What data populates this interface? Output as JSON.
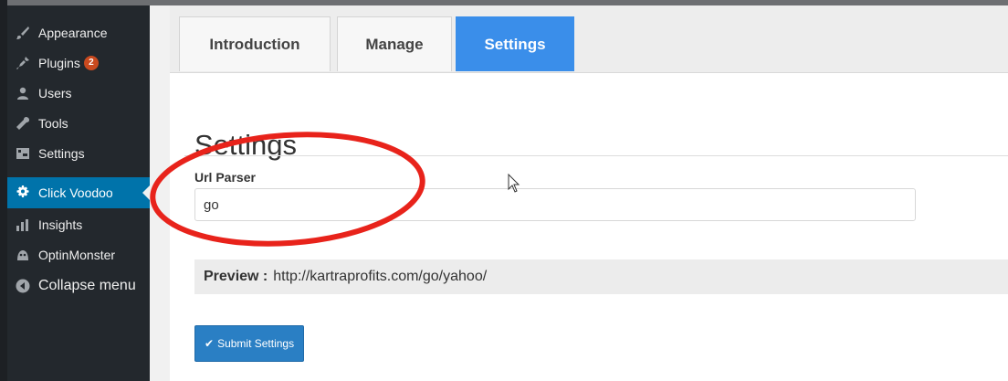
{
  "sidebar": {
    "items": [
      {
        "label": "Appearance",
        "icon": "paintbrush-icon"
      },
      {
        "label": "Plugins",
        "icon": "plugin-icon",
        "badge": "2"
      },
      {
        "label": "Users",
        "icon": "users-icon"
      },
      {
        "label": "Tools",
        "icon": "wrench-icon"
      },
      {
        "label": "Settings",
        "icon": "settings-icon"
      },
      {
        "label": "Click Voodoo",
        "icon": "gear-icon",
        "active": true
      },
      {
        "label": "Insights",
        "icon": "insights-icon"
      },
      {
        "label": "OptinMonster",
        "icon": "optinmonster-icon"
      },
      {
        "label": "Collapse menu",
        "icon": "collapse-icon"
      }
    ]
  },
  "tabs": [
    {
      "label": "Introduction"
    },
    {
      "label": "Manage"
    },
    {
      "label": "Settings",
      "active": true
    }
  ],
  "main": {
    "title": "Settings",
    "url_parser_label": "Url Parser",
    "url_parser_value": "go",
    "preview_label": "Preview :",
    "preview_url": "http://kartraprofits.com/go/yahoo/",
    "submit_label": "Submit Settings"
  },
  "colors": {
    "sidebar_bg": "#23282d",
    "active_item": "#0073aa",
    "active_tab": "#3a8eea",
    "badge": "#ca4a1f",
    "annotation": "#e8231b"
  }
}
